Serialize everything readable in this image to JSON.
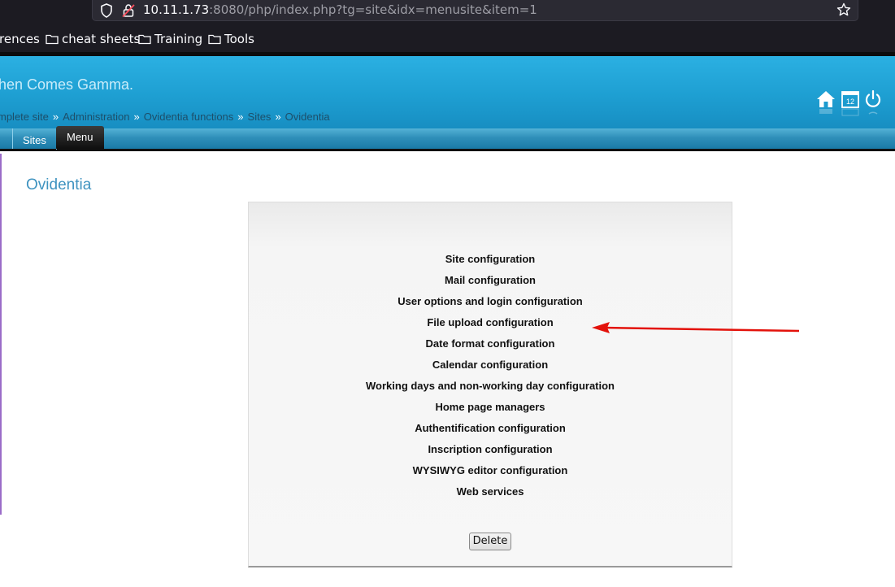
{
  "browser": {
    "url_host": "10.11.1.73",
    "url_rest": ":8080/php/index.php?tg=site&idx=menusite&item=1",
    "bookmarks": [
      {
        "label": "rences"
      },
      {
        "label": "cheat sheets"
      },
      {
        "label": "Training"
      },
      {
        "label": "Tools"
      }
    ]
  },
  "header": {
    "site_title": "hen Comes Gamma.",
    "breadcrumb": [
      "mplete site",
      "Administration",
      "Ovidentia functions",
      "Sites",
      "Ovidentia"
    ],
    "breadcrumb_separator": "»",
    "icons": [
      "home-icon",
      "calendar-icon",
      "power-icon"
    ],
    "calendar_number": "12"
  },
  "nav": {
    "tabs": [
      {
        "label": "Sites",
        "active": false
      },
      {
        "label": "Menu",
        "active": true
      }
    ]
  },
  "main": {
    "heading": "Ovidentia",
    "menu_items": [
      "Site configuration",
      "Mail configuration",
      "User options and login configuration",
      "File upload configuration",
      "Date format configuration",
      "Calendar configuration",
      "Working days and non-working day configuration",
      "Home page managers",
      "Authentification configuration",
      "Inscription configuration",
      "WYSIWYG editor configuration",
      "Web services"
    ],
    "delete_label": "Delete"
  },
  "colors": {
    "header_blue": "#1e9fd2",
    "heading_blue": "#3f93c0",
    "annotation_red": "#e3120b"
  }
}
